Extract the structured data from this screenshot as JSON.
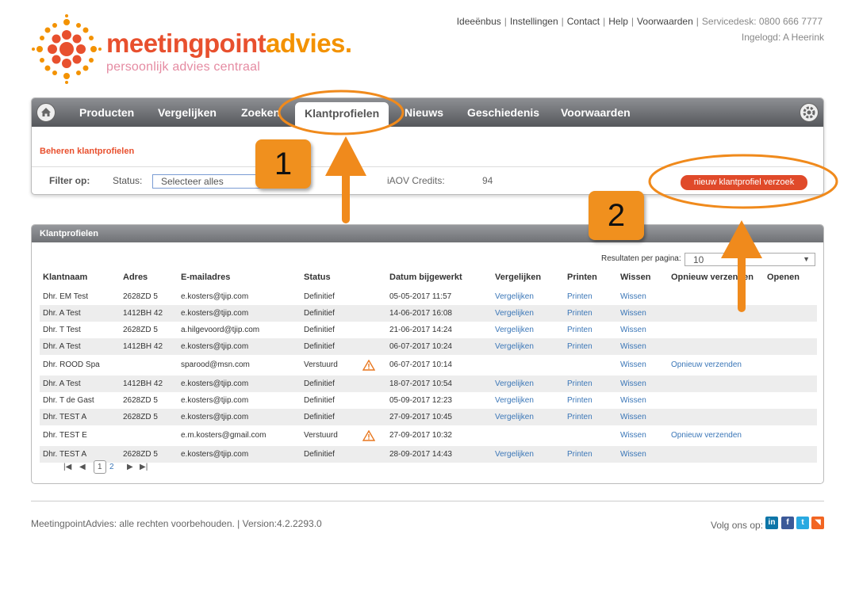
{
  "brand": {
    "name_a": "meetingpoint",
    "name_b": "advies.",
    "tagline": "persoonlijk advies centraal",
    "color_primary": "#e8502e",
    "color_secondary": "#f39200"
  },
  "toplinks": {
    "ideeenbus": "Ideeënbus",
    "instellingen": "Instellingen",
    "contact": "Contact",
    "help": "Help",
    "voorwaarden": "Voorwaarden",
    "servicedesk": "Servicedesk: 0800 666 7777",
    "login": "Ingelogd: A Heerink"
  },
  "nav": {
    "items": [
      "Producten",
      "Vergelijken",
      "Zoeken",
      "Klantprofielen",
      "Nieuws",
      "Geschiedenis",
      "Voorwaarden"
    ],
    "active": "Klantprofielen"
  },
  "subnav": {
    "title": "Beheren klantprofielen",
    "filter_label": "Filter op:",
    "status_label": "Status:",
    "status_value": "Selecteer alles",
    "credits_label": "iAOV Credits:",
    "credits_value": "94",
    "new_button": "nieuw klantprofiel verzoek"
  },
  "table": {
    "panel_title": "Klantprofielen",
    "rpp_label": "Resultaten per pagina:",
    "rpp_value": "10",
    "headers": [
      "Klantnaam",
      "Adres",
      "E-mailadres",
      "Status",
      "Datum bijgewerkt",
      "Vergelijken",
      "Printen",
      "Wissen",
      "Opnieuw verzenden",
      "Openen"
    ],
    "rows": [
      {
        "name": "Dhr. EM Test",
        "adres": "2628ZD 5",
        "email": "e.kosters@tjip.com",
        "status": "Definitief",
        "warn": false,
        "datum": "05-05-2017 11:57",
        "vergelijken": "Vergelijken",
        "printen": "Printen",
        "wissen": "Wissen",
        "opnieuw": ""
      },
      {
        "name": "Dhr. A Test",
        "adres": "1412BH 42",
        "email": "e.kosters@tjip.com",
        "status": "Definitief",
        "warn": false,
        "datum": "14-06-2017 16:08",
        "vergelijken": "Vergelijken",
        "printen": "Printen",
        "wissen": "Wissen",
        "opnieuw": ""
      },
      {
        "name": "Dhr. T Test",
        "adres": "2628ZD 5",
        "email": "a.hilgevoord@tjip.com",
        "status": "Definitief",
        "warn": false,
        "datum": "21-06-2017 14:24",
        "vergelijken": "Vergelijken",
        "printen": "Printen",
        "wissen": "Wissen",
        "opnieuw": ""
      },
      {
        "name": "Dhr. A Test",
        "adres": "1412BH 42",
        "email": "e.kosters@tjip.com",
        "status": "Definitief",
        "warn": false,
        "datum": "06-07-2017 10:24",
        "vergelijken": "Vergelijken",
        "printen": "Printen",
        "wissen": "Wissen",
        "opnieuw": ""
      },
      {
        "name": "Dhr. ROOD Spa",
        "adres": "",
        "email": "sparood@msn.com",
        "status": "Verstuurd",
        "warn": true,
        "datum": "06-07-2017 10:14",
        "vergelijken": "",
        "printen": "",
        "wissen": "Wissen",
        "opnieuw": "Opnieuw verzenden"
      },
      {
        "name": "Dhr. A Test",
        "adres": "1412BH 42",
        "email": "e.kosters@tjip.com",
        "status": "Definitief",
        "warn": false,
        "datum": "18-07-2017 10:54",
        "vergelijken": "Vergelijken",
        "printen": "Printen",
        "wissen": "Wissen",
        "opnieuw": ""
      },
      {
        "name": "Dhr. T de Gast",
        "adres": "2628ZD 5",
        "email": "e.kosters@tjip.com",
        "status": "Definitief",
        "warn": false,
        "datum": "05-09-2017 12:23",
        "vergelijken": "Vergelijken",
        "printen": "Printen",
        "wissen": "Wissen",
        "opnieuw": ""
      },
      {
        "name": "Dhr. TEST A",
        "adres": "2628ZD 5",
        "email": "e.kosters@tjip.com",
        "status": "Definitief",
        "warn": false,
        "datum": "27-09-2017 10:45",
        "vergelijken": "Vergelijken",
        "printen": "Printen",
        "wissen": "Wissen",
        "opnieuw": ""
      },
      {
        "name": "Dhr. TEST E",
        "adres": "",
        "email": "e.m.kosters@gmail.com",
        "status": "Verstuurd",
        "warn": true,
        "datum": "27-09-2017 10:32",
        "vergelijken": "",
        "printen": "",
        "wissen": "Wissen",
        "opnieuw": "Opnieuw verzenden"
      },
      {
        "name": "Dhr. TEST A",
        "adres": "2628ZD 5",
        "email": "e.kosters@tjip.com",
        "status": "Definitief",
        "warn": false,
        "datum": "28-09-2017 14:43",
        "vergelijken": "Vergelijken",
        "printen": "Printen",
        "wissen": "Wissen",
        "opnieuw": ""
      }
    ],
    "pager": {
      "pages": [
        "1",
        "2"
      ],
      "current": "1"
    }
  },
  "footer": {
    "text": "MeetingpointAdvies: alle rechten voorbehouden. | Version:4.2.2293.0",
    "follow": "Volg ons op:",
    "social_icons": [
      {
        "icon": "linkedin-icon",
        "glyph": "in",
        "color": "#0e76a8"
      },
      {
        "icon": "facebook-icon",
        "glyph": "f",
        "color": "#3b5998"
      },
      {
        "icon": "twitter-icon",
        "glyph": "t",
        "color": "#29a9e1"
      },
      {
        "icon": "rss-icon",
        "glyph": "◥",
        "color": "#f26522"
      }
    ]
  },
  "annotations": {
    "callout_1": "1",
    "callout_2": "2",
    "color": "#f08a1c"
  }
}
